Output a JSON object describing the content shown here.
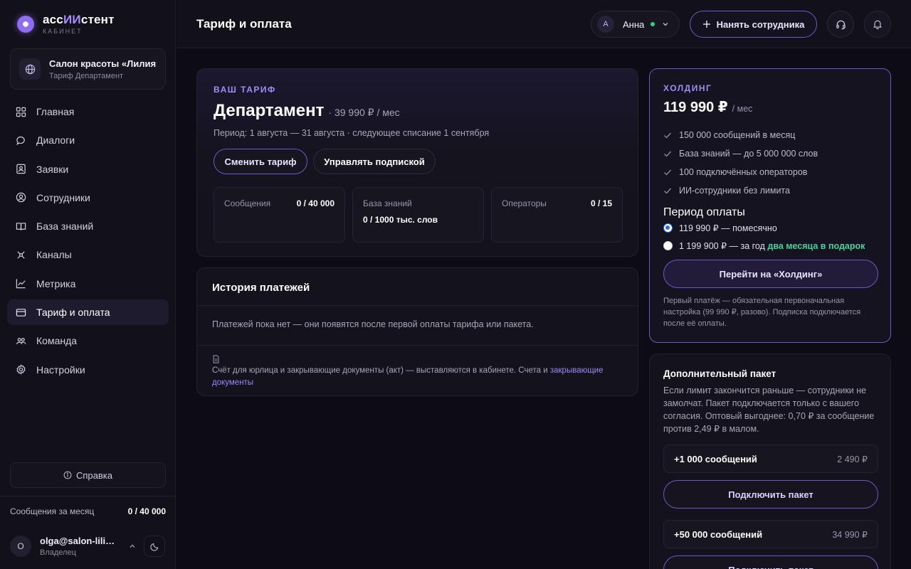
{
  "brand": {
    "name_prefix": "асс",
    "name_accent": "ИИ",
    "name_suffix": "стент",
    "sub": "КАБИНЕТ"
  },
  "org": {
    "name": "Салон красоты «Лилия»",
    "plan": "Тариф Департамент"
  },
  "sidebar": {
    "items": [
      {
        "label": "Главная",
        "icon": "grid-icon"
      },
      {
        "label": "Диалоги",
        "icon": "chat-icon"
      },
      {
        "label": "Заявки",
        "icon": "request-icon"
      },
      {
        "label": "Сотрудники",
        "icon": "user-circle-icon"
      },
      {
        "label": "База знаний",
        "icon": "book-icon"
      },
      {
        "label": "Каналы",
        "icon": "channels-icon"
      },
      {
        "label": "Метрика",
        "icon": "chart-line-icon"
      },
      {
        "label": "Тариф и оплата",
        "icon": "card-icon",
        "active": true
      },
      {
        "label": "Команда",
        "icon": "team-icon"
      },
      {
        "label": "Настройки",
        "icon": "gear-icon"
      }
    ],
    "help_label": "Справка",
    "usage_label": "Сообщения за месяц",
    "usage_value": "0 / 40 000",
    "user_initial": "O",
    "user_email": "olga@salon-liliya.ru",
    "user_role": "Владелец"
  },
  "header": {
    "title": "Тариф и оплата",
    "user_initial": "A",
    "user_name": "Анна",
    "hire_label": "Нанять сотрудника"
  },
  "plan": {
    "eyebrow": "ВАШ ТАРИФ",
    "name": "Департамент",
    "price": "· 39 990 ₽ / мес",
    "period": "Период: 1 августа — 31 августа · следующее списание 1 сентября",
    "change_label": "Сменить тариф",
    "manage_label": "Управлять подпиской",
    "metrics": [
      {
        "label": "Сообщения",
        "value": "0 / 40 000"
      },
      {
        "label": "База знаний",
        "value": "0 / 1000 тыс. слов"
      },
      {
        "label": "Операторы",
        "value": "0 / 15"
      }
    ]
  },
  "history": {
    "title": "История платежей",
    "empty": "Платежей пока нет — они появятся после первой оплаты тарифа или пакета.",
    "doc_note": "Счёт для юрлица и закрывающие документы (акт) — выставляются в кабинете. Счета и",
    "doc_link": "закрывающие документы"
  },
  "holding": {
    "eyebrow": "ХОЛДИНГ",
    "price": "119 990 ₽",
    "per": "/ мес",
    "features": [
      "150 000 сообщений в месяц",
      "База знаний — до 5 000 000 слов",
      "100 подключённых операторов",
      "ИИ-сотрудники без лимита"
    ],
    "period_title": "Период оплаты",
    "option_month": "119 990 ₽ — помесячно",
    "option_year": "1 199 900 ₽ — за год",
    "option_year_bonus": "два месяца в подарок",
    "go_label": "Перейти на «Холдинг»",
    "note": "Первый платёж — обязательная первоначальная настройка (99 990 ₽, разово). Подписка подключается после её оплаты."
  },
  "addon": {
    "title": "Дополнительный пакет",
    "desc": "Если лимит закончится раньше — сотрудники не замолчат. Пакет подключается только с вашего согласия. Оптовый выгоднее: 0,70 ₽ за сообщение против 2,49 ₽ в малом.",
    "packs": [
      {
        "name": "+1 000 сообщений",
        "price": "2 490 ₽"
      },
      {
        "name": "+50 000 сообщений",
        "price": "34 990 ₽"
      }
    ],
    "connect_label": "Подключить пакет"
  },
  "colors": {
    "accent": "#6e58c8",
    "accent_text": "#a48cf5",
    "success": "#2fd08a",
    "background": "#0d0c14"
  }
}
